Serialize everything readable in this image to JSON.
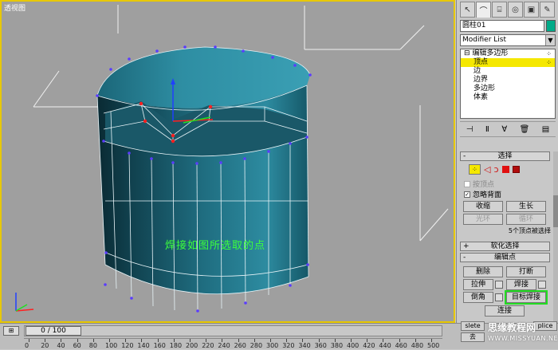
{
  "viewport": {
    "label": "透视图",
    "annotation": "焊接如图所选取的点"
  },
  "panel": {
    "tab_icons": [
      "cursor-icon",
      "bend-icon",
      "hierarchy-icon",
      "motion-icon",
      "display-icon",
      "utilities-icon"
    ],
    "object_name": "圆柱01",
    "object_color": "#00aa88",
    "modifier_list": "Modifier List",
    "stack": {
      "root": "编辑多边形",
      "items": [
        "顶点",
        "边",
        "边界",
        "多边形",
        "体素"
      ],
      "selected_index": 0
    },
    "selection_rollout": {
      "title": "选择",
      "by_vertex_label": "按顶点",
      "ignore_backfacing_label": "忽略背面",
      "shrink_label": "收缩",
      "grow_label": "生长",
      "ring_label": "光环",
      "loop_label": "循环",
      "selection_info": "5个顶点被选择"
    },
    "soft_selection_title": "软化选择",
    "edit_vertices": {
      "title": "编辑点",
      "remove_label": "删除",
      "break_label": "打断",
      "extrude_label": "拉伸",
      "weld_label": "焊接",
      "chamfer_label": "倒角",
      "target_weld_label": "目标焊接",
      "connect_label": "连接"
    }
  },
  "timeline": {
    "frame_readout": "0 / 100",
    "ticks": [
      "0",
      "20",
      "40",
      "60",
      "80",
      "100",
      "120",
      "140",
      "160",
      "180",
      "200",
      "220",
      "240",
      "260",
      "280",
      "300",
      "320",
      "340",
      "360",
      "380",
      "400",
      "420",
      "440",
      "460",
      "480",
      "500"
    ]
  },
  "bottom": {
    "btn_a": "slete",
    "btn_b": "plice",
    "btn_c": "去"
  },
  "watermark": {
    "line1": "思缘教程网",
    "line2": "WWW.MISSYUAN.NET"
  }
}
